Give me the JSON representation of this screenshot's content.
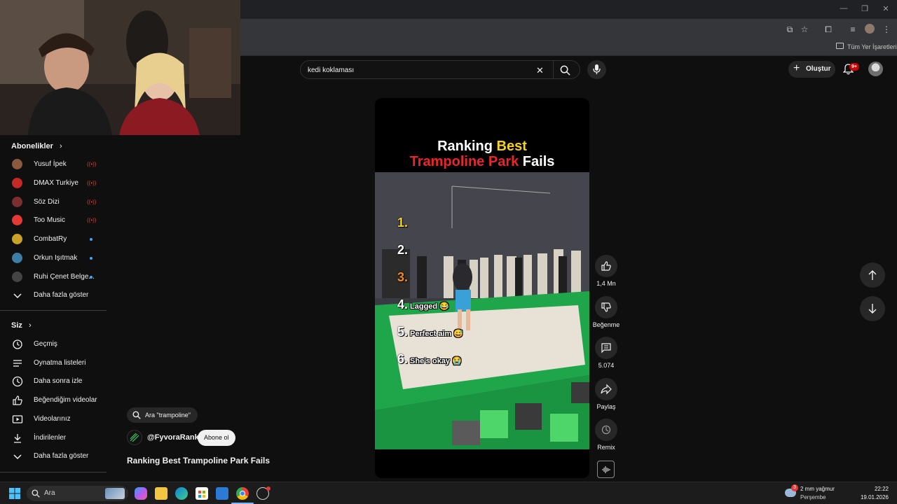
{
  "browser": {
    "bookmarks_folder": "Tüm Yer İşaretleri"
  },
  "header": {
    "search_value": "kedi koklaması",
    "create_label": "Oluştur",
    "notification_badge": "9+"
  },
  "sidebar": {
    "subscriptions_heading": "Abonelikler",
    "channels": [
      {
        "name": "Yusuf İpek",
        "status": "live",
        "color": "#8a5a3c"
      },
      {
        "name": "DMAX Turkiye",
        "status": "live",
        "color": "#c62828"
      },
      {
        "name": "Söz Dizi",
        "status": "live",
        "color": "#7b2f2f"
      },
      {
        "name": "Too Music",
        "status": "live",
        "color": "#e53935"
      },
      {
        "name": "CombatRy",
        "status": "new",
        "color": "#c9a227"
      },
      {
        "name": "Orkun Işıtmak",
        "status": "new",
        "color": "#3d7ea6"
      },
      {
        "name": "Ruhi Çenet Belge...",
        "status": "new",
        "color": "#444444"
      }
    ],
    "show_more_1": "Daha fazla göster",
    "you_heading": "Siz",
    "you_items": [
      {
        "label": "Geçmiş",
        "icon": "history-icon"
      },
      {
        "label": "Oynatma listeleri",
        "icon": "playlist-icon"
      },
      {
        "label": "Daha sonra izle",
        "icon": "watch-later-icon"
      },
      {
        "label": "Beğendiğim videolar",
        "icon": "like-icon"
      },
      {
        "label": "Videolarınız",
        "icon": "your-videos-icon"
      },
      {
        "label": "İndirilenler",
        "icon": "download-icon"
      }
    ],
    "show_more_2": "Daha fazla göster"
  },
  "video": {
    "title_line1_white": "Ranking",
    "title_line1_yellow": "Best",
    "title_line2_red": "Trampoline Park",
    "title_line2_white": "Fails",
    "ranks": [
      {
        "num": "1.",
        "caption": ""
      },
      {
        "num": "2.",
        "caption": ""
      },
      {
        "num": "3.",
        "caption": ""
      },
      {
        "num": "4.",
        "caption": "Lagged 😂"
      },
      {
        "num": "5.",
        "caption": "Perfect aim 😅"
      },
      {
        "num": "6.",
        "caption": "She's okay 😭"
      }
    ],
    "search_chip": "Ara \"trampoline\"",
    "channel": "@FyvoraRank",
    "subscribe_label": "Abone ol",
    "caption_title": "Ranking Best Trampoline Park Fails"
  },
  "actions": {
    "likes": "1,4 Mn",
    "dislike_label": "Beğenme",
    "comments": "5.074",
    "share_label": "Paylaş",
    "remix_label": "Remix"
  },
  "taskbar": {
    "search_placeholder": "Ara",
    "weather_temp": "2 mm yağmur",
    "weather_day": "Perşembe",
    "weather_badge": "3",
    "time": "22:22",
    "date": "19.01.2026"
  },
  "colors": {
    "accent_red": "#e53935",
    "title_yellow": "#f5d21f",
    "title_red": "#e8262b",
    "trampoline_green": "#1fa64a"
  }
}
